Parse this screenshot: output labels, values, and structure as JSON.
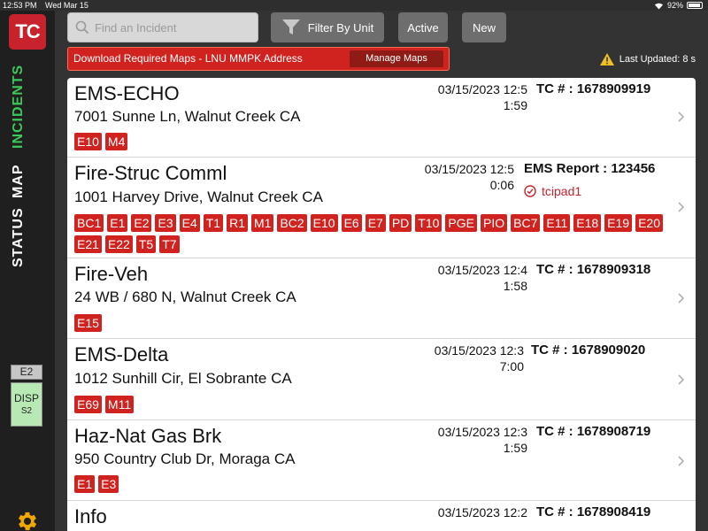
{
  "status_bar": {
    "time": "12:53 PM",
    "date": "Wed Mar 15",
    "battery": "92%"
  },
  "sidebar": {
    "logo": "TC",
    "nav": [
      "INCIDENTS",
      "MAP",
      "STATUS"
    ],
    "unit_tag": "E2",
    "disp_label": "DISP",
    "disp_sub": "S2"
  },
  "toolbar": {
    "search_placeholder": "Find an Incident",
    "filter_label": "Filter By Unit",
    "active_label": "Active",
    "new_label": "New"
  },
  "banner": {
    "text": "Download Required Maps - LNU MMPK Address",
    "manage_label": "Manage Maps"
  },
  "last_updated": "Last Updated: 8 s",
  "incidents": [
    {
      "type": "EMS-ECHO",
      "address": "7001 Sunne Ln, Walnut Creek CA",
      "datetime_line1": "03/15/2023 12:5",
      "datetime_line2": "1:59",
      "tc": "TC # : 1678909919",
      "units": [
        "E10",
        "M4"
      ]
    },
    {
      "type": "Fire-Struc Comml",
      "address": "1001 Harvey Drive, Walnut Creek CA",
      "datetime_line1": "03/15/2023 12:5",
      "datetime_line2": "0:06",
      "tc": "EMS Report : 123456",
      "ems_user": "tcipad1",
      "units": [
        "BC1",
        "E1",
        "E2",
        "E3",
        "E4",
        "T1",
        "R1",
        "M1",
        "BC2",
        "E10",
        "E6",
        "E7",
        "PD",
        "T10",
        "PGE",
        "PIO",
        "BC7",
        "E11",
        "E18",
        "E19",
        "E20",
        "E21",
        "E22",
        "T5",
        "T7"
      ]
    },
    {
      "type": "Fire-Veh",
      "address": "24 WB / 680 N, Walnut Creek CA",
      "datetime_line1": "03/15/2023 12:4",
      "datetime_line2": "1:58",
      "tc": "TC # : 1678909318",
      "units": [
        "E15"
      ]
    },
    {
      "type": "EMS-Delta",
      "address": "1012 Sunhill Cir, El Sobrante CA",
      "datetime_line1": "03/15/2023 12:3",
      "datetime_line2": "7:00",
      "tc": "TC # : 1678909020",
      "units": [
        "E69",
        "M11"
      ]
    },
    {
      "type": "Haz-Nat Gas Brk",
      "address": "950 Country Club Dr, Moraga CA",
      "datetime_line1": "03/15/2023 12:3",
      "datetime_line2": "1:59",
      "tc": "TC # : 1678908719",
      "units": [
        "E1",
        "E3"
      ]
    },
    {
      "type": "Info",
      "address": "",
      "datetime_line1": "03/15/2023 12:2",
      "datetime_line2": "",
      "tc": "TC # : 1678908419",
      "units": []
    }
  ]
}
